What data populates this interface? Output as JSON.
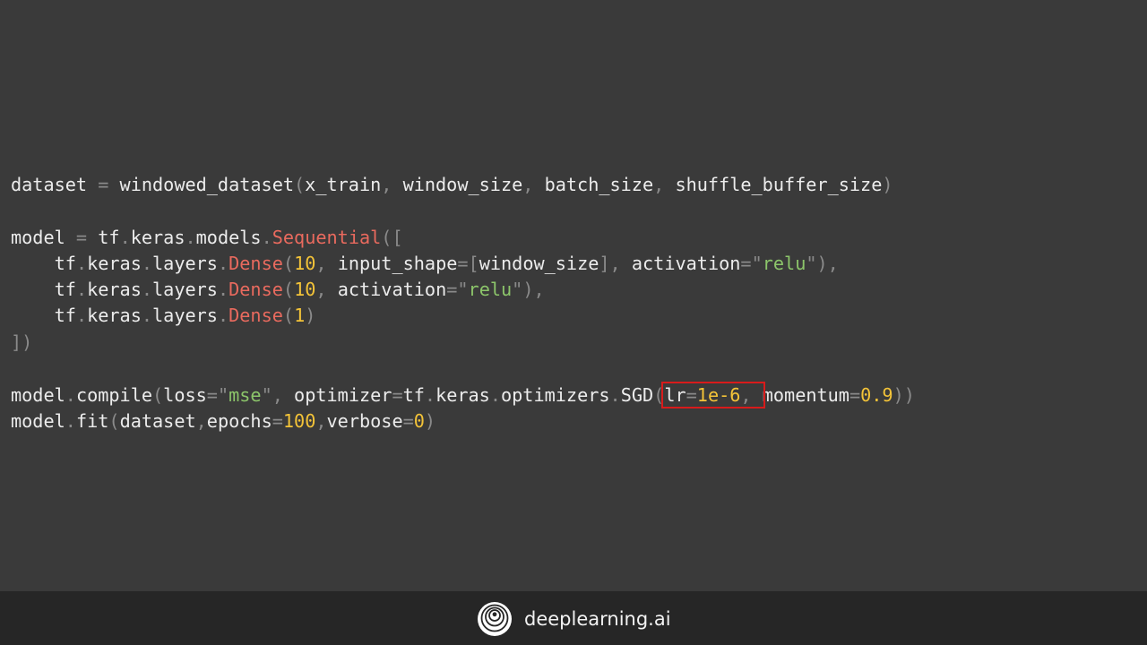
{
  "code": {
    "l1": {
      "a": "dataset",
      "b": " = ",
      "c": "windowed_dataset",
      "d": "(",
      "e": "x_train",
      "f": ", ",
      "g": "window_size",
      "h": ", ",
      "i": "batch_size",
      "j": ", ",
      "k": "shuffle_buffer_size",
      "l": ")"
    },
    "l2": {
      "a": "model",
      "b": " = ",
      "c": "tf",
      "d": ".",
      "e": "keras",
      "f": ".",
      "g": "models",
      "h": ".",
      "i": "Sequential",
      "j": "(["
    },
    "l3": {
      "indent": "    ",
      "a": "tf",
      "b": ".",
      "c": "keras",
      "d": ".",
      "e": "layers",
      "f": ".",
      "g": "Dense",
      "h": "(",
      "i": "10",
      "j": ", ",
      "k": "input_shape",
      "l": "=[",
      "m": "window_size",
      "n": "], ",
      "o": "activation",
      "p": "=\"",
      "q": "relu",
      "r": "\"),"
    },
    "l4": {
      "indent": "    ",
      "a": "tf",
      "b": ".",
      "c": "keras",
      "d": ".",
      "e": "layers",
      "f": ".",
      "g": "Dense",
      "h": "(",
      "i": "10",
      "j": ", ",
      "k": "activation",
      "l": "=\"",
      "m": "relu",
      "n": "\"),"
    },
    "l5": {
      "indent": "    ",
      "a": "tf",
      "b": ".",
      "c": "keras",
      "d": ".",
      "e": "layers",
      "f": ".",
      "g": "Dense",
      "h": "(",
      "i": "1",
      "j": ")"
    },
    "l6": {
      "a": "])"
    },
    "l7": {
      "a": "model",
      "b": ".",
      "c": "compile",
      "d": "(",
      "e": "loss",
      "f": "=\"",
      "g": "mse",
      "h": "\", ",
      "i": "optimizer",
      "j": "=",
      "k": "tf",
      "l": ".",
      "m": "keras",
      "n": ".",
      "o": "optimizers",
      "p": ".",
      "q": "SGD",
      "r": "(",
      "s": "lr",
      "t": "=",
      "u": "1e-6",
      "v": ", ",
      "w": "momentum",
      "x": "=",
      "y": "0.9",
      "z": "))"
    },
    "l8": {
      "a": "model",
      "b": ".",
      "c": "fit",
      "d": "(",
      "e": "dataset",
      "f": ",",
      "g": "epochs",
      "h": "=",
      "i": "100",
      "j": ",",
      "k": "verbose",
      "l": "=",
      "m": "0",
      "n": ")"
    }
  },
  "footer": {
    "brand": "deeplearning.ai",
    "logo_icon": "deeplearning-ai-logo-icon"
  },
  "colors": {
    "background": "#3a3a3a",
    "footer_background": "#262626",
    "text": "#ececec",
    "punctuation": "#8a8a8a",
    "class_name": "#e96a5e",
    "string": "#8cc56a",
    "number": "#f3c338",
    "highlight_box": "#d81b1b"
  }
}
